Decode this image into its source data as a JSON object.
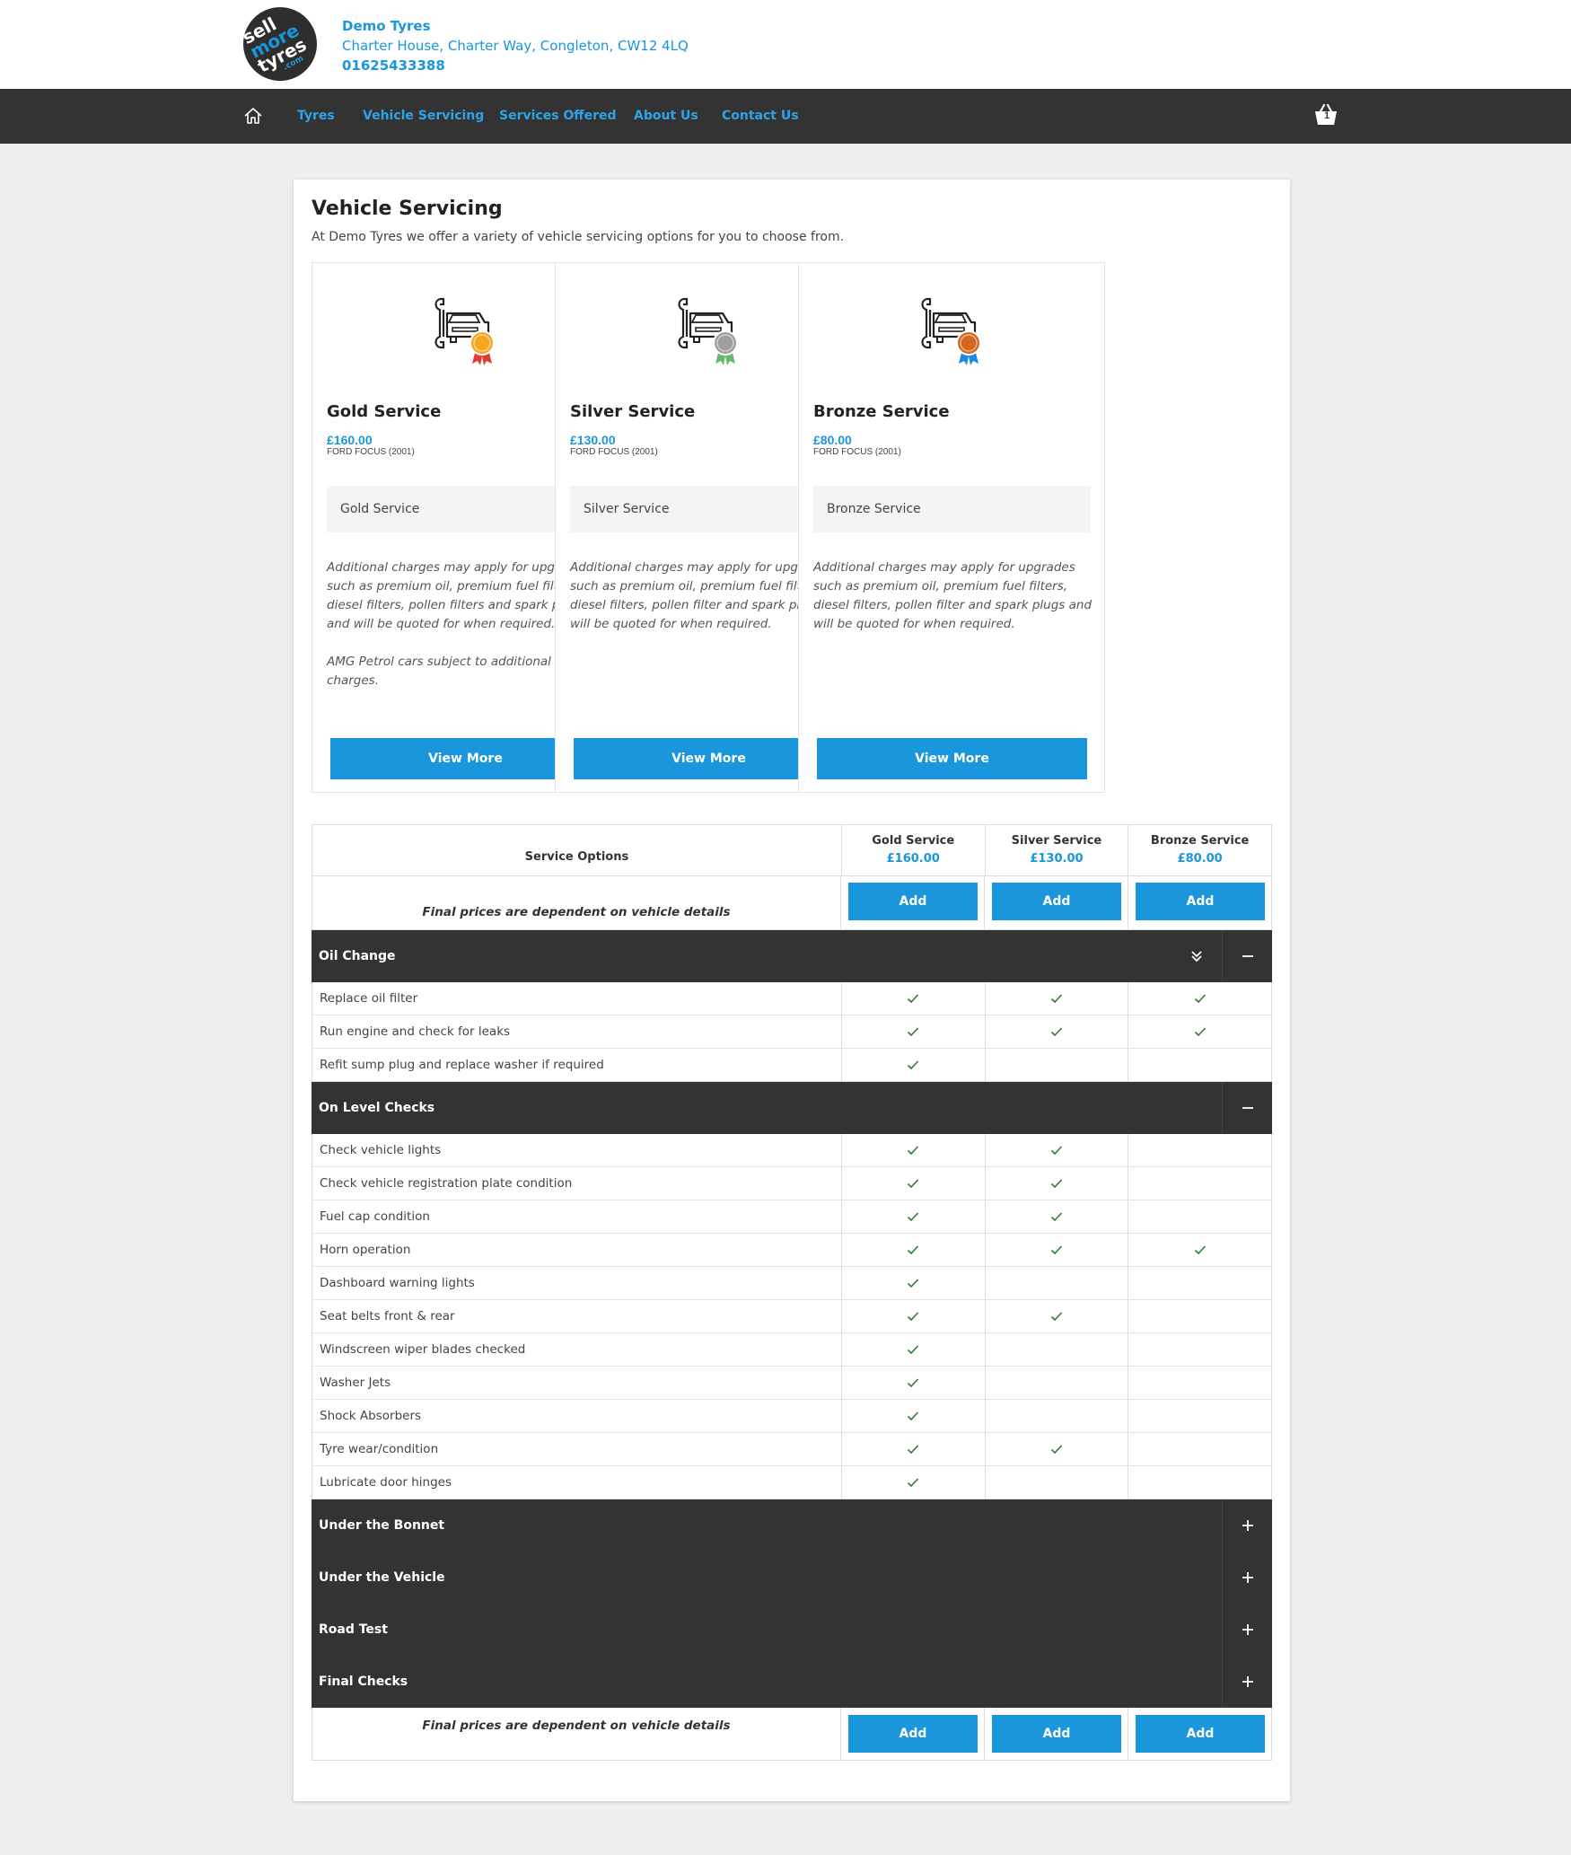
{
  "logo": {
    "line1": "sell",
    "line2": "more",
    "line3": "tyres",
    "line4": ".com"
  },
  "company": {
    "name": "Demo Tyres",
    "address": "Charter House, Charter Way, Congleton, CW12 4LQ",
    "phone": "01625433388"
  },
  "nav": {
    "items": [
      "Tyres",
      "Vehicle Servicing",
      "Services Offered",
      "About Us",
      "Contact Us"
    ],
    "cart_count": "1"
  },
  "page": {
    "title": "Vehicle Servicing",
    "intro": "At Demo Tyres we offer a variety of vehicle servicing options for you to choose from."
  },
  "cards": [
    {
      "title": "Gold Service",
      "price": "£160.00",
      "vehicle": "FORD FOCUS (2001)",
      "select": "Gold Service",
      "desc1": "Additional charges may apply for upgrades such as premium oil, premium fuel filters, diesel filters, pollen filters and spark plugs and will be quoted for when required.",
      "desc2": "AMG Petrol cars subject to additional charges.",
      "button": "View More",
      "medal_color": "#f5a623",
      "ribbon_color": "#e53935"
    },
    {
      "title": "Silver Service",
      "price": "£130.00",
      "vehicle": "FORD FOCUS (2001)",
      "select": "Silver Service",
      "desc1": "Additional charges may apply for upgrades such as premium oil, premium fuel filters, diesel filters, pollen filter and spark plugs and will be quoted for when required.",
      "desc2": "",
      "button": "View More",
      "medal_color": "#9e9e9e",
      "ribbon_color": "#66bb6a"
    },
    {
      "title": "Bronze Service",
      "price": "£80.00",
      "vehicle": "FORD FOCUS (2001)",
      "select": "Bronze Service",
      "desc1": "Additional charges may apply for upgrades such as premium oil, premium fuel filters, diesel filters, pollen filter and spark plugs and will be quoted for when required.",
      "desc2": "",
      "button": "View More",
      "medal_color": "#d2691e",
      "ribbon_color": "#1e88e5"
    }
  ],
  "table": {
    "options_header": "Service Options",
    "tiers": [
      {
        "name": "Gold Service",
        "price": "£160.00"
      },
      {
        "name": "Silver Service",
        "price": "£130.00"
      },
      {
        "name": "Bronze Service",
        "price": "£80.00"
      }
    ],
    "note": "Final prices are dependent on vehicle details",
    "add_label": "Add",
    "sections": [
      {
        "title": "Oil Change",
        "expanded": true,
        "items": [
          {
            "label": "Replace oil filter",
            "tiers": [
              true,
              true,
              true
            ]
          },
          {
            "label": "Run engine and check for leaks",
            "tiers": [
              true,
              true,
              true
            ]
          },
          {
            "label": "Refit sump plug and replace washer if required",
            "tiers": [
              true,
              false,
              false
            ]
          }
        ]
      },
      {
        "title": "On Level Checks",
        "expanded": true,
        "items": [
          {
            "label": "Check vehicle lights",
            "tiers": [
              true,
              true,
              false
            ]
          },
          {
            "label": "Check vehicle registration plate condition",
            "tiers": [
              true,
              true,
              false
            ]
          },
          {
            "label": "Fuel cap condition",
            "tiers": [
              true,
              true,
              false
            ]
          },
          {
            "label": "Horn operation",
            "tiers": [
              true,
              true,
              true
            ]
          },
          {
            "label": "Dashboard warning lights",
            "tiers": [
              true,
              false,
              false
            ]
          },
          {
            "label": "Seat belts front & rear",
            "tiers": [
              true,
              true,
              false
            ]
          },
          {
            "label": "Windscreen wiper blades checked",
            "tiers": [
              true,
              false,
              false
            ]
          },
          {
            "label": "Washer Jets",
            "tiers": [
              true,
              false,
              false
            ]
          },
          {
            "label": "Shock Absorbers",
            "tiers": [
              true,
              false,
              false
            ]
          },
          {
            "label": "Tyre wear/condition",
            "tiers": [
              true,
              true,
              false
            ]
          },
          {
            "label": "Lubricate door hinges",
            "tiers": [
              true,
              false,
              false
            ]
          }
        ]
      },
      {
        "title": "Under the Bonnet",
        "expanded": false,
        "items": []
      },
      {
        "title": "Under the Vehicle",
        "expanded": false,
        "items": []
      },
      {
        "title": "Road Test",
        "expanded": false,
        "items": []
      },
      {
        "title": "Final Checks",
        "expanded": false,
        "items": []
      }
    ]
  },
  "colors": {
    "accent": "#1a96dc",
    "dark": "#333333",
    "check": "#2e7d32"
  },
  "icons": {
    "home": "home-icon",
    "cart": "basket-icon",
    "check": "check-icon",
    "expand_all": "double-chevron-down-icon",
    "collapse": "minus-icon",
    "expand": "plus-icon"
  }
}
